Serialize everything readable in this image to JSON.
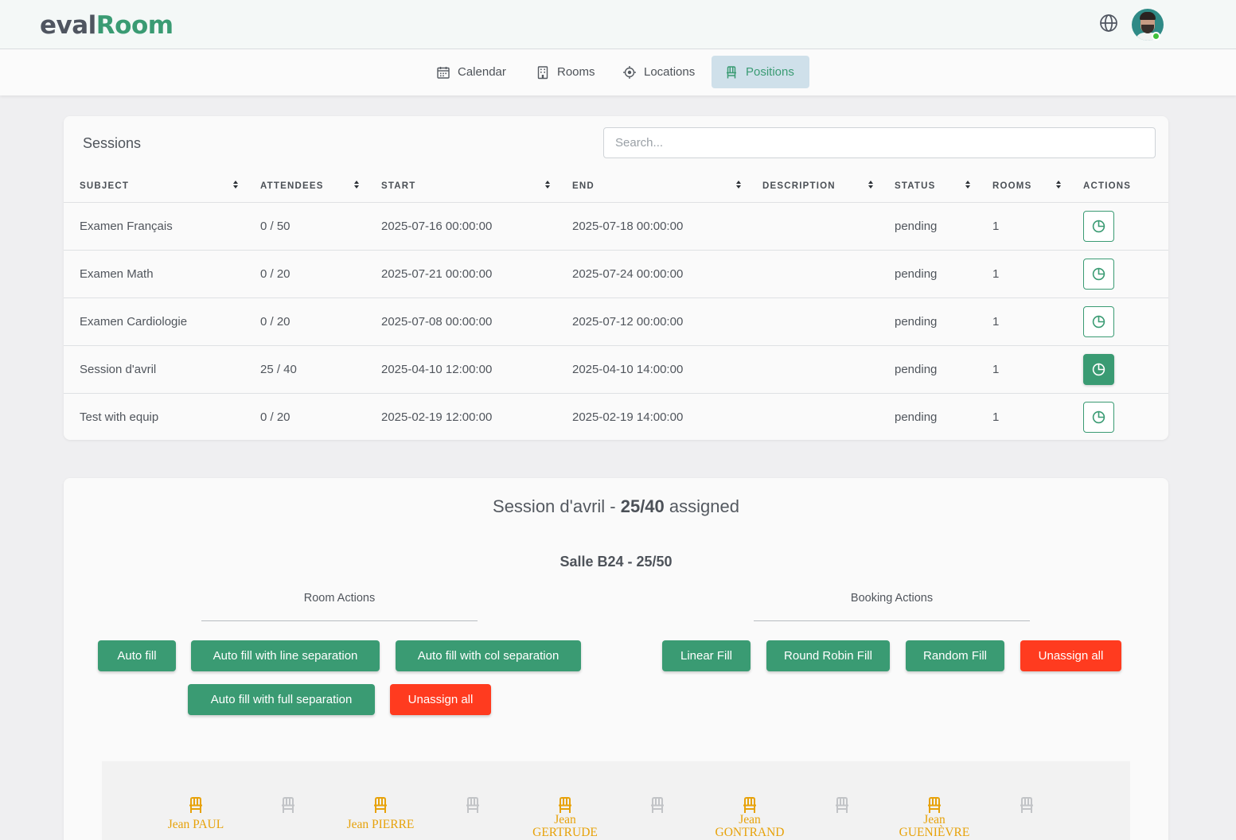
{
  "app": {
    "logo_part1": "eval",
    "logo_part2": "Room"
  },
  "header": {
    "globe_icon": "globe-icon",
    "avatar_alt": "user-avatar"
  },
  "nav": {
    "items": [
      {
        "label": "Calendar",
        "icon": "calendar-icon",
        "active": false
      },
      {
        "label": "Rooms",
        "icon": "building-icon",
        "active": false
      },
      {
        "label": "Locations",
        "icon": "location-target-icon",
        "active": false
      },
      {
        "label": "Positions",
        "icon": "chair-icon",
        "active": true
      }
    ]
  },
  "sessions": {
    "title": "Sessions",
    "search_placeholder": "Search...",
    "columns": [
      "SUBJECT",
      "ATTENDEES",
      "START",
      "END",
      "DESCRIPTION",
      "STATUS",
      "ROOMS",
      "ACTIONS"
    ],
    "rows": [
      {
        "subject": "Examen Français",
        "attendees": "0 / 50",
        "start": "2025-07-16 00:00:00",
        "end": "2025-07-18 00:00:00",
        "description": "",
        "status": "pending",
        "rooms": "1",
        "selected": false
      },
      {
        "subject": "Examen Math",
        "attendees": "0 / 20",
        "start": "2025-07-21 00:00:00",
        "end": "2025-07-24 00:00:00",
        "description": "",
        "status": "pending",
        "rooms": "1",
        "selected": false
      },
      {
        "subject": "Examen Cardiologie",
        "attendees": "0 / 20",
        "start": "2025-07-08 00:00:00",
        "end": "2025-07-12 00:00:00",
        "description": "",
        "status": "pending",
        "rooms": "1",
        "selected": false
      },
      {
        "subject": "Session d'avril",
        "attendees": "25 / 40",
        "start": "2025-04-10 12:00:00",
        "end": "2025-04-10 14:00:00",
        "description": "",
        "status": "pending",
        "rooms": "1",
        "selected": true
      },
      {
        "subject": "Test with equip",
        "attendees": "0 / 20",
        "start": "2025-02-19 12:00:00",
        "end": "2025-02-19 14:00:00",
        "description": "",
        "status": "pending",
        "rooms": "1",
        "selected": false
      }
    ]
  },
  "assignment": {
    "session_name": "Session d'avril - ",
    "count": "25/40",
    "suffix": " assigned",
    "room_title": "Salle B24 - 25/50",
    "room_actions": {
      "label": "Room Actions",
      "buttons": [
        "Auto fill",
        "Auto fill with line separation",
        "Auto fill with col separation",
        "Auto fill with full separation",
        "Unassign all"
      ]
    },
    "booking_actions": {
      "label": "Booking Actions",
      "buttons": [
        "Linear Fill",
        "Round Robin Fill",
        "Random Fill",
        "Unassign all"
      ]
    },
    "seats": [
      {
        "occupied": true,
        "line1": "Jean  PAUL",
        "line2": ""
      },
      {
        "occupied": false,
        "line1": "",
        "line2": ""
      },
      {
        "occupied": true,
        "line1": "Jean  PIERRE",
        "line2": ""
      },
      {
        "occupied": false,
        "line1": "",
        "line2": ""
      },
      {
        "occupied": true,
        "line1": "Jean",
        "line2": "GERTRUDE"
      },
      {
        "occupied": false,
        "line1": "",
        "line2": ""
      },
      {
        "occupied": true,
        "line1": "Jean",
        "line2": "GONTRAND"
      },
      {
        "occupied": false,
        "line1": "",
        "line2": ""
      },
      {
        "occupied": true,
        "line1": "Jean",
        "line2": "GUENIÈVRE"
      },
      {
        "occupied": false,
        "line1": "",
        "line2": ""
      }
    ]
  },
  "colors": {
    "accent": "#3a9b73",
    "danger": "#ff3b1f",
    "seat_occupied": "#e7a20a",
    "seat_empty": "#c2c4c7"
  }
}
